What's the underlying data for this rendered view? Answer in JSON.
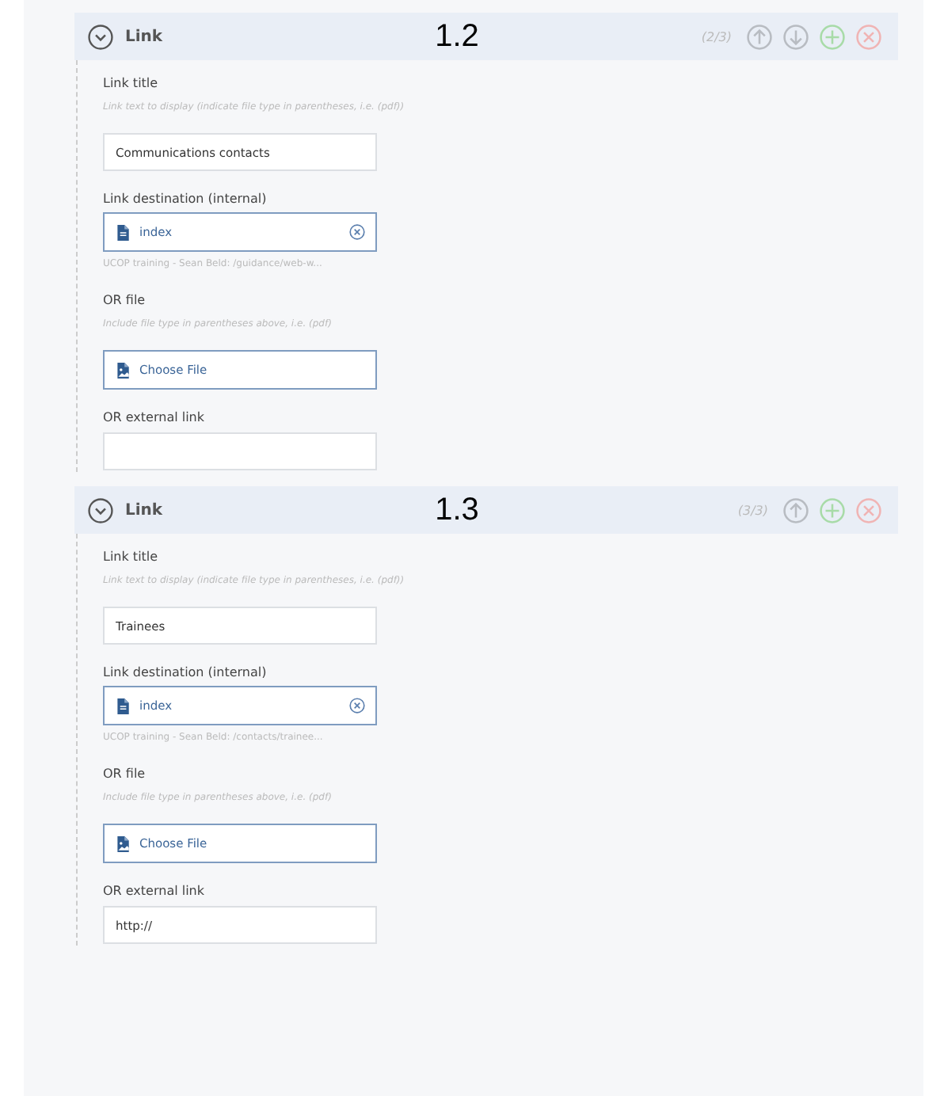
{
  "sections": [
    {
      "title": "Link",
      "annotation": "1.2",
      "counter": "(2/3)",
      "expanded": true,
      "actions": [
        {
          "kind": "up"
        },
        {
          "kind": "down"
        },
        {
          "kind": "add"
        },
        {
          "kind": "remove"
        }
      ],
      "fields": [
        {
          "kind": "text",
          "label": "Link title",
          "hint": "Link text to display (indicate file type in parentheses, i.e. (pdf))",
          "value": "Communications contacts"
        },
        {
          "kind": "page",
          "label": "Link destination (internal)",
          "value": "index",
          "path": "UCOP training - Sean Beld: /guidance/web-w..."
        },
        {
          "kind": "file",
          "label": "OR file",
          "hint": "Include file type in parentheses above, i.e. (pdf)",
          "value": "Choose File"
        },
        {
          "kind": "text",
          "label": "OR external link"
        }
      ]
    },
    {
      "title": "Link",
      "annotation": "1.3",
      "counter": "(3/3)",
      "expanded": true,
      "actions": [
        {
          "kind": "up"
        },
        {
          "kind": "add"
        },
        {
          "kind": "remove"
        }
      ],
      "fields": [
        {
          "kind": "text",
          "label": "Link title",
          "hint": "Link text to display (indicate file type in parentheses, i.e. (pdf))",
          "value": "Trainees"
        },
        {
          "kind": "page",
          "label": "Link destination (internal)",
          "value": "index",
          "path": "UCOP training - Sean Beld: /contacts/trainee..."
        },
        {
          "kind": "file",
          "label": "OR file",
          "hint": "Include file type in parentheses above, i.e. (pdf)",
          "value": "Choose File"
        },
        {
          "kind": "text",
          "label": "OR external link",
          "value": "http://"
        }
      ]
    }
  ]
}
